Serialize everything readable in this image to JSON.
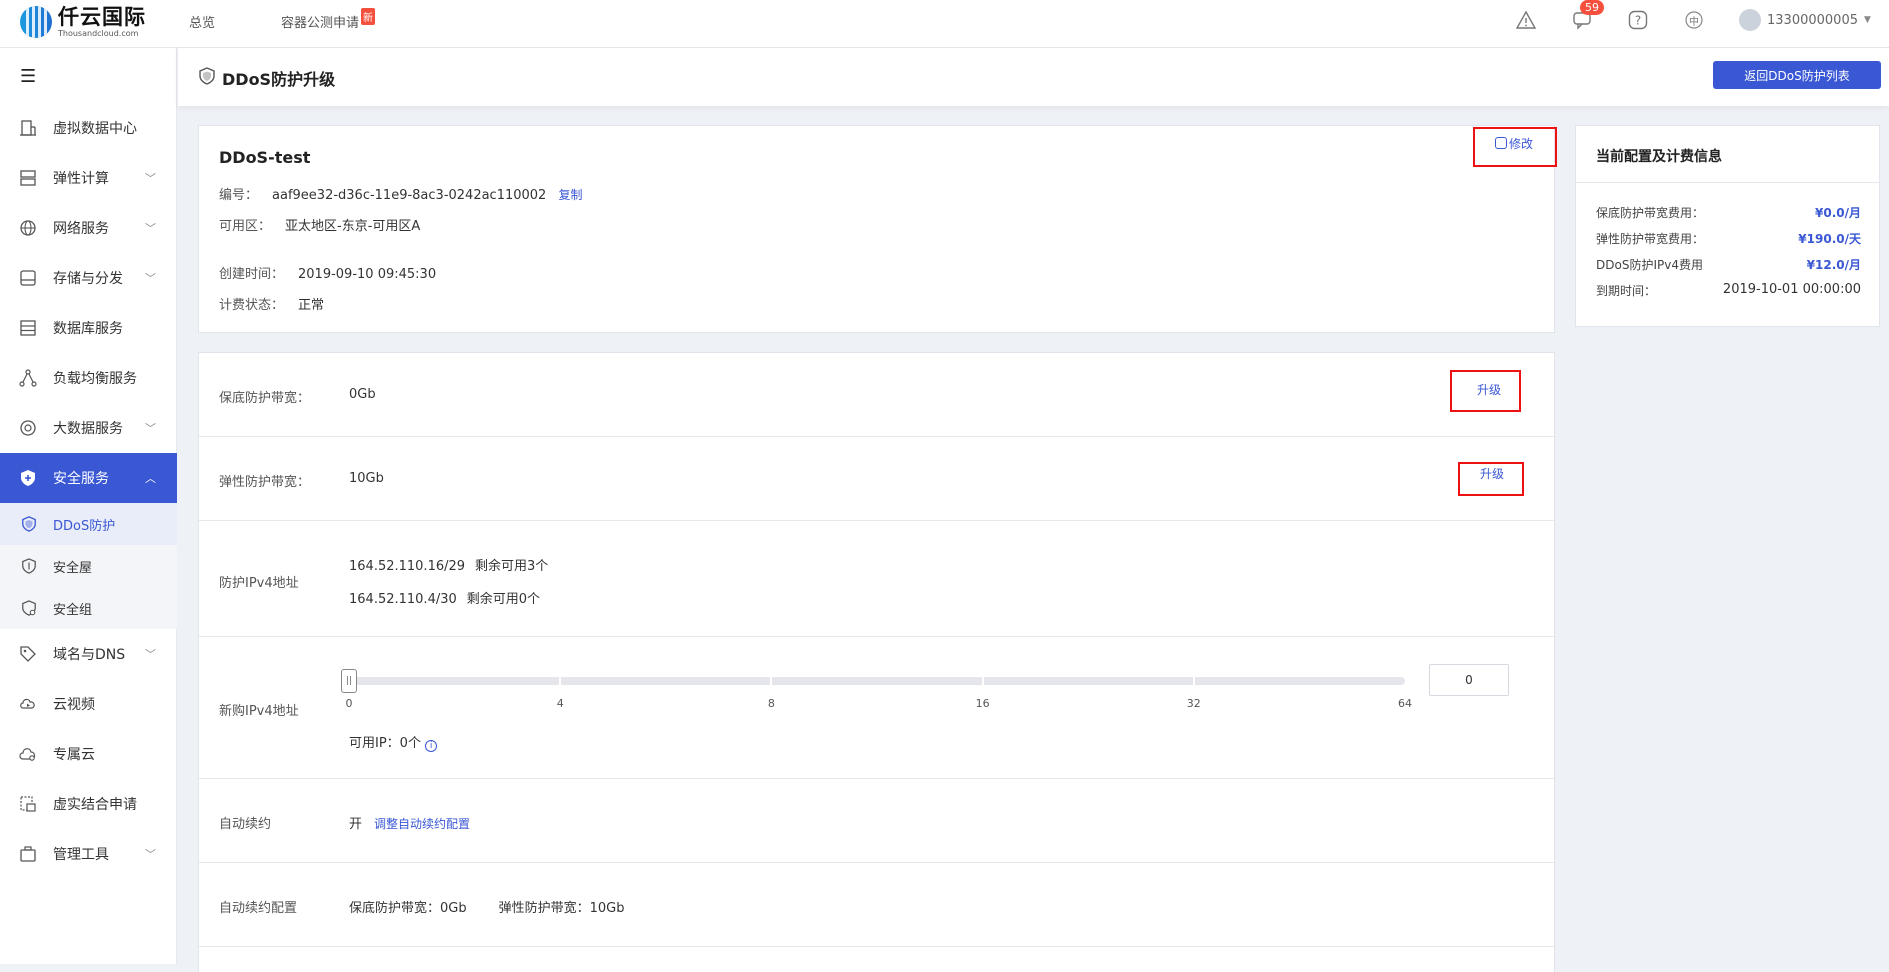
{
  "topbar": {
    "logo_cn": "仟云国际",
    "logo_en": "Thousandcloud.com",
    "nav": [
      "总览",
      "容器公测申请"
    ],
    "new_tag": "新",
    "message_count": "59",
    "lang": "中",
    "user": "13300000005",
    "icons": [
      "alert-icon",
      "message-icon",
      "help-icon",
      "language-icon",
      "avatar-icon"
    ]
  },
  "sidebar": {
    "menu_icon": "☰",
    "items": [
      {
        "label": "虚拟数据中心",
        "icon": "building-icon",
        "expandable": false
      },
      {
        "label": "弹性计算",
        "icon": "server-icon",
        "expandable": true
      },
      {
        "label": "网络服务",
        "icon": "globe-icon",
        "expandable": true
      },
      {
        "label": "存储与分发",
        "icon": "storage-icon",
        "expandable": true
      },
      {
        "label": "数据库服务",
        "icon": "database-icon",
        "expandable": false
      },
      {
        "label": "负载均衡服务",
        "icon": "network-icon",
        "expandable": false
      },
      {
        "label": "大数据服务",
        "icon": "bigdata-icon",
        "expandable": true
      },
      {
        "label": "安全服务",
        "icon": "shield-icon",
        "expandable": true,
        "active": true
      },
      {
        "label": "域名与DNS",
        "icon": "tag-icon",
        "expandable": true
      },
      {
        "label": "云视频",
        "icon": "video-icon",
        "expandable": false
      },
      {
        "label": "专属云",
        "icon": "cloud-icon",
        "expandable": false
      },
      {
        "label": "虚实结合申请",
        "icon": "apply-icon",
        "expandable": false
      },
      {
        "label": "管理工具",
        "icon": "toolbox-icon",
        "expandable": true
      }
    ],
    "sub_items": [
      {
        "label": "DDoS防护",
        "icon": "ddos-shield-icon",
        "active": true
      },
      {
        "label": "安全屋",
        "icon": "safehouse-icon",
        "active": false
      },
      {
        "label": "安全组",
        "icon": "security-group-icon",
        "active": false
      }
    ]
  },
  "header": {
    "title": "DDoS防护升级",
    "back_button": "返回DDoS防护列表"
  },
  "instance": {
    "name": "DDoS-test",
    "edit_label": "修改",
    "id_label": "编号：",
    "id_value": "aaf9ee32-d36c-11e9-8ac3-0242ac110002",
    "copy_label": "复制",
    "zone_label": "可用区：",
    "zone_value": "亚太地区-东京-可用区A",
    "created_label": "创建时间：",
    "created_value": "2019-09-10 09:45:30",
    "billing_label": "计费状态：",
    "billing_value": "正常"
  },
  "form": {
    "base_bw_label": "保底防护带宽：",
    "base_bw_value": "0Gb",
    "elastic_bw_label": "弹性防护带宽：",
    "elastic_bw_value": "10Gb",
    "upgrade_label": "升级",
    "ipv4_label": "防护IPv4地址",
    "ipv4_list": [
      {
        "addr": "164.52.110.16/29",
        "remain": "剩余可用3个"
      },
      {
        "addr": "164.52.110.4/30",
        "remain": "剩余可用0个"
      }
    ],
    "new_ipv4_label": "新购IPv4地址",
    "slider_ticks": [
      "0",
      "4",
      "8",
      "16",
      "32",
      "64"
    ],
    "slider_value": 0,
    "input_value": "0",
    "available_ip": "可用IP：0个",
    "auto_renew_label": "自动续约",
    "auto_renew_value": "开",
    "auto_renew_link": "调整自动续约配置",
    "auto_renew_cfg_label": "自动续约配置",
    "auto_renew_cfg_base": "保底防护带宽：0Gb",
    "auto_renew_cfg_elastic": "弹性防护带宽：10Gb"
  },
  "billing_panel": {
    "title": "当前配置及计费信息",
    "rows": [
      {
        "label": "保底防护带宽费用：",
        "value": "¥0.0/月"
      },
      {
        "label": "弹性防护带宽费用：",
        "value": "¥190.0/天"
      },
      {
        "label": "DDoS防护IPv4费用",
        "value": "¥12.0/月"
      },
      {
        "label": "到期时间：",
        "value": "2019-10-01 00:00:00"
      }
    ]
  },
  "colors": {
    "accent": "#3a57d4",
    "highlight_box": "#e11111",
    "badge": "#f5503d"
  }
}
